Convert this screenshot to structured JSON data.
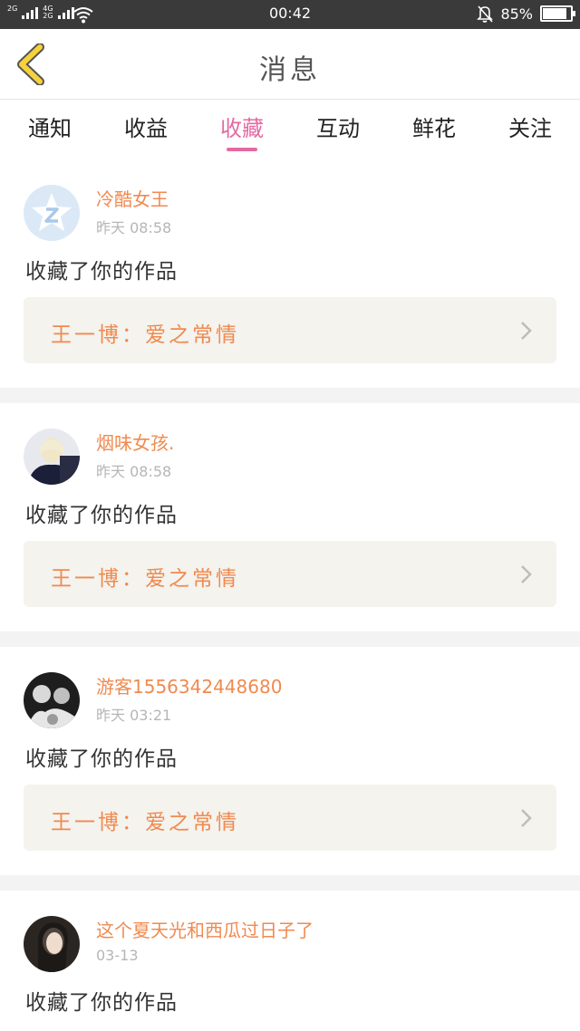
{
  "status_bar": {
    "net_top": "2G",
    "net_left_mid": "4G",
    "net_left_bottom": "2G",
    "time": "00:42",
    "battery": "85%",
    "battery_level": 0.85
  },
  "header": {
    "title": "消息"
  },
  "tabs": [
    {
      "label": "通知",
      "active": false
    },
    {
      "label": "收益",
      "active": false
    },
    {
      "label": "收藏",
      "active": true
    },
    {
      "label": "互动",
      "active": false
    },
    {
      "label": "鲜花",
      "active": false
    },
    {
      "label": "关注",
      "active": false
    }
  ],
  "messages": [
    {
      "user": "冷酷女王",
      "time": "昨天 08:58",
      "action": "收藏了你的作品",
      "work": "王一博：爱之常情",
      "avatar": "default-avatar-icon"
    },
    {
      "user": "烟味女孩.",
      "time": "昨天 08:58",
      "action": "收藏了你的作品",
      "work": "王一博：爱之常情",
      "avatar": "photo"
    },
    {
      "user": "游客1556342448680",
      "time": "昨天 03:21",
      "action": "收藏了你的作品",
      "work": "王一博：爱之常情",
      "avatar": "photo"
    },
    {
      "user": "这个夏天光和西瓜过日子了",
      "time": "03-13",
      "action": "收藏了你的作品",
      "work": "",
      "avatar": "photo"
    }
  ],
  "colors": {
    "accent": "#e46aa3",
    "name": "#f08a50",
    "back_arrow": "#f6d23a"
  }
}
